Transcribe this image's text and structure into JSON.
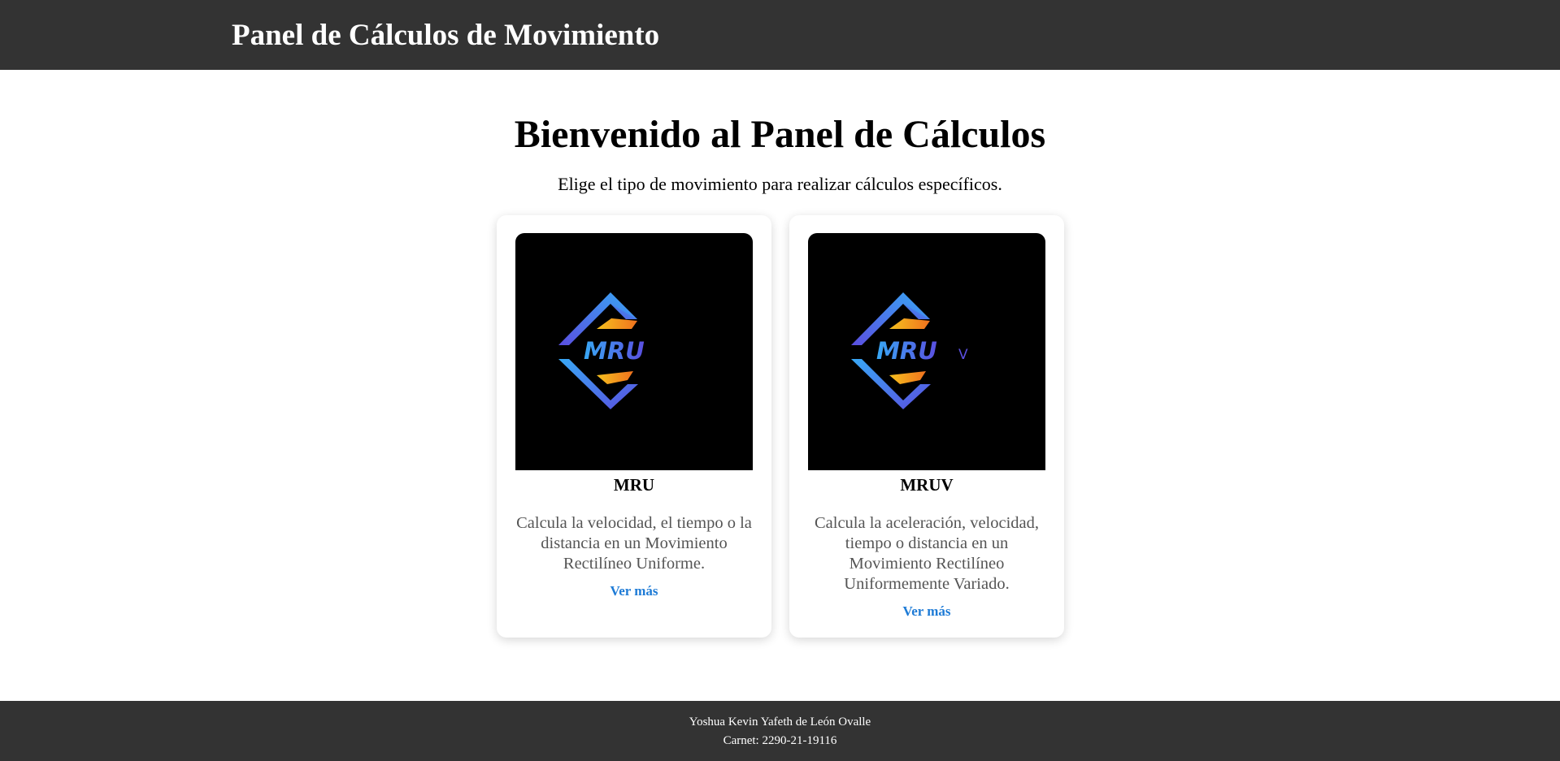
{
  "header": {
    "title": "Panel de Cálculos de Movimiento"
  },
  "main": {
    "heading": "Bienvenido al Panel de Cálculos",
    "subtitle": "Elige el tipo de movimiento para realizar cálculos específicos.",
    "cards": [
      {
        "logo_text": "MRU",
        "title": "MRU",
        "description": "Calcula la velocidad, el tiempo o la distancia en un Movimiento Rectilíneo Uniforme.",
        "link_label": "Ver más"
      },
      {
        "logo_text": "MRU",
        "logo_suffix": "V",
        "title": "MRUV",
        "description": "Calcula la aceleración, velocidad, tiempo o distancia en un Movimiento Rectilíneo Uniformemente Variado.",
        "link_label": "Ver más"
      }
    ]
  },
  "footer": {
    "name": "Yoshua Kevin Yafeth de León Ovalle",
    "carnet": "Carnet: 2290-21-19116"
  },
  "colors": {
    "header_bg": "#333333",
    "footer_bg": "#333333",
    "link": "#1e7bd6",
    "description_text": "#555555",
    "logo_blue": "#3a8ef0",
    "logo_purple": "#5a4fe0",
    "logo_orange": "#f59a1e"
  }
}
